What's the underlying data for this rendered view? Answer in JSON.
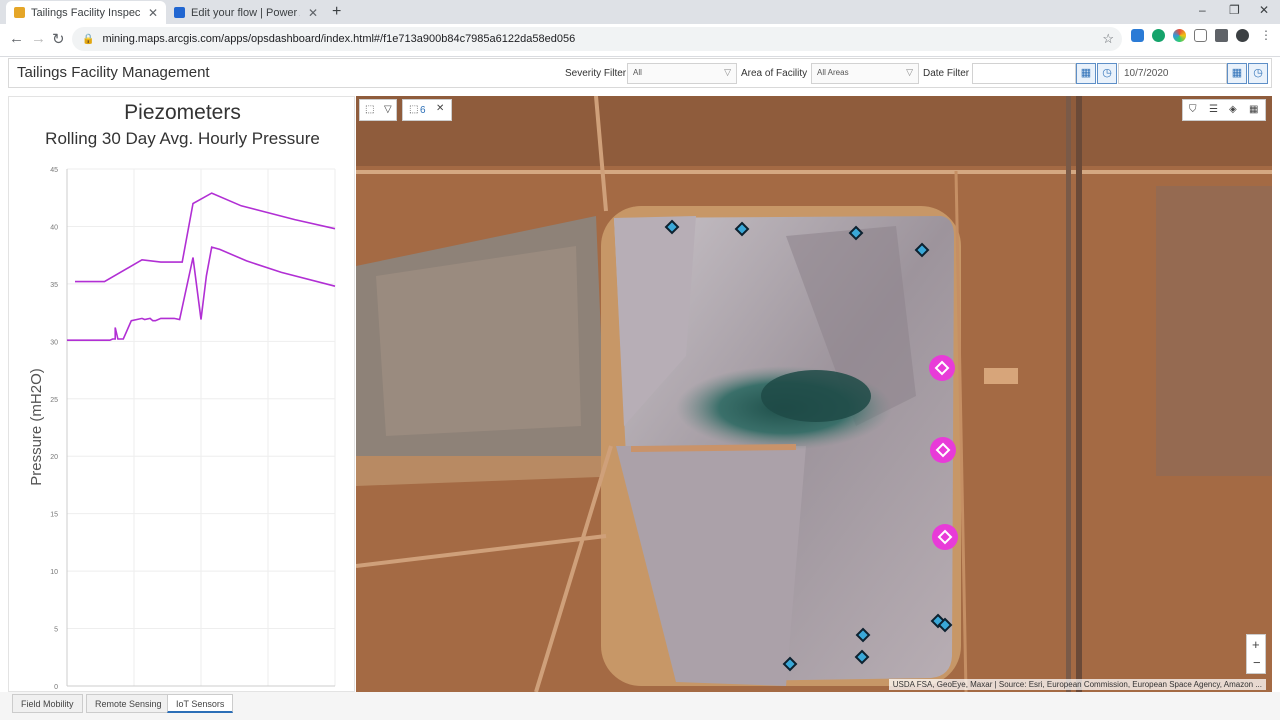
{
  "browser": {
    "tabs": [
      {
        "title": "Tailings Facility Inspection",
        "active": true
      },
      {
        "title": "Edit your flow | Power Automate",
        "active": false
      }
    ],
    "url": "mining.maps.arcgis.com/apps/opsdashboard/index.html#/f1e713a900b84c7985a6122da58ed056"
  },
  "dashboard": {
    "title": "Tailings Facility Management",
    "severity_label": "Severity Filter",
    "severity_value": "All",
    "area_label": "Area of Facility",
    "area_value": "All Areas",
    "date_label": "Date Filter",
    "date_value": "10/7/2020"
  },
  "chart": {
    "title": "Piezometers",
    "subtitle": "Rolling 30 Day Avg. Hourly Pressure",
    "ylabel": "Pressure (mH2O)"
  },
  "chart_data": {
    "type": "line",
    "title": "Piezometers",
    "subtitle": "Rolling 30 Day Avg. Hourly Pressure",
    "ylabel": "Pressure (mH2O)",
    "xlabel": "",
    "ylim": [
      0,
      45
    ],
    "yticks": [
      0,
      5,
      10,
      15,
      20,
      25,
      30,
      35,
      40,
      45
    ],
    "grid": true,
    "line_color": "#b12fd4",
    "series": [
      {
        "x": [
          0.03,
          0.1,
          0.14,
          0.28,
          0.35,
          0.43,
          0.47,
          0.54,
          0.65,
          0.85,
          1.0
        ],
        "y": [
          35.2,
          35.2,
          35.2,
          37.1,
          36.9,
          36.9,
          42.0,
          42.9,
          41.8,
          40.6,
          39.8
        ]
      },
      {
        "x": [
          0.0,
          0.15,
          0.16,
          0.17,
          0.18,
          0.18,
          0.19,
          0.21,
          0.24,
          0.28,
          0.29,
          0.31,
          0.32,
          0.33,
          0.35,
          0.37,
          0.4,
          0.42,
          0.47,
          0.5,
          0.52,
          0.54,
          0.57,
          0.67,
          0.8,
          1.0
        ],
        "y": [
          30.1,
          30.1,
          30.1,
          30.2,
          30.2,
          31.2,
          30.2,
          30.2,
          31.8,
          32.0,
          31.9,
          32.0,
          31.8,
          31.8,
          32.0,
          32.0,
          32.0,
          31.9,
          37.3,
          31.9,
          35.7,
          38.2,
          38.0,
          37.0,
          36.0,
          34.8
        ]
      }
    ]
  },
  "map": {
    "attribution": "USDA FSA, GeoEye, Maxar | Source: Esri, European Commission, European Space Agency, Amazon ...",
    "selection_count": "6",
    "sensors_blue": 10,
    "sensors_alert": 3,
    "colors": {
      "sensor": "#3aa8d8",
      "alert": "#e83bd8",
      "sand": "#b47a4a"
    }
  },
  "bottom_tabs": [
    {
      "label": "Field Mobility"
    },
    {
      "label": "Remote Sensing"
    },
    {
      "label": "IoT Sensors",
      "selected": true
    }
  ]
}
